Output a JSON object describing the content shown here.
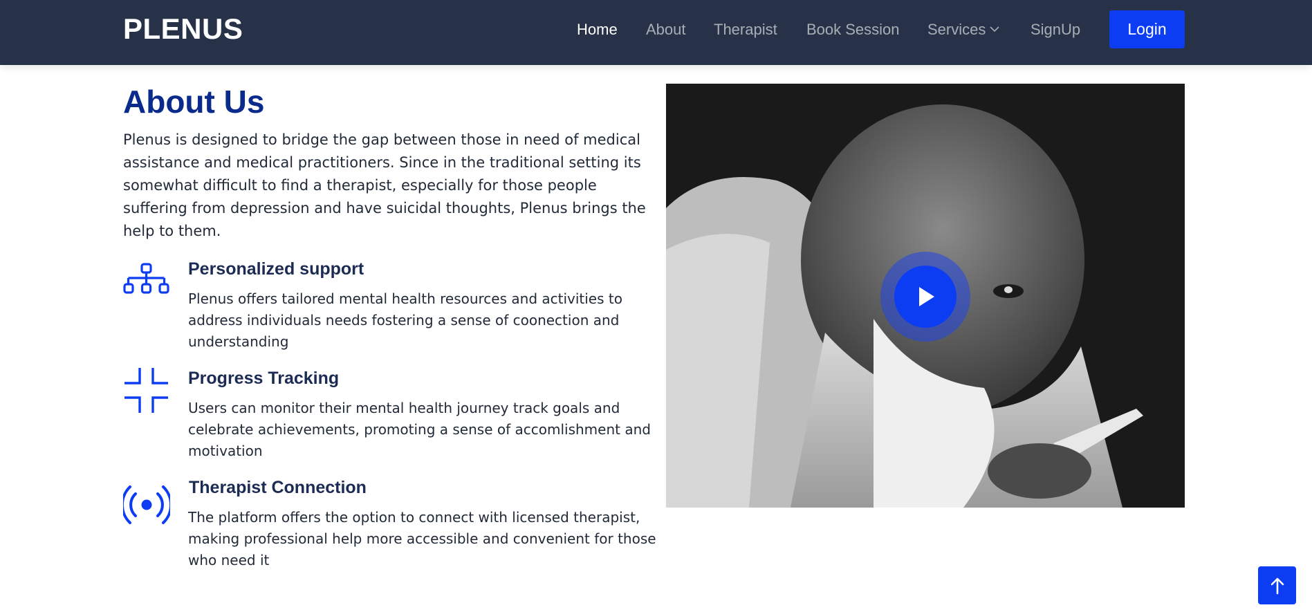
{
  "brand": "PLENUS",
  "nav": {
    "home": "Home",
    "about": "About",
    "therapist": "Therapist",
    "book": "Book Session",
    "services": "Services",
    "signup": "SignUp",
    "login": "Login"
  },
  "about": {
    "title": "About Us",
    "description": "Plenus is designed to bridge the gap between those in need of medical assistance and medical practitioners. Since in the traditional setting its somewhat difficult to find a therapist, especially for those people suffering from depression and have suicidal thoughts, Plenus brings the help to them."
  },
  "features": [
    {
      "title": "Personalized support",
      "text": "Plenus offers tailored mental health resources and activities to address individuals needs fostering a sense of coonection and understanding",
      "icon": "diagram-tree-icon"
    },
    {
      "title": "Progress Tracking",
      "text": "Users can monitor their mental health journey track goals and celebrate achievements, promoting a sense of accomlishment and motivation",
      "icon": "collapse-corners-icon"
    },
    {
      "title": "Therapist Connection",
      "text": "The platform offers the option to connect with licensed therapist, making professional help more accessible and convenient for those who need it",
      "icon": "broadcast-icon"
    }
  ],
  "colors": {
    "navbar": "#273248",
    "accent": "#0d3df2",
    "heading": "#0a2a8c"
  }
}
